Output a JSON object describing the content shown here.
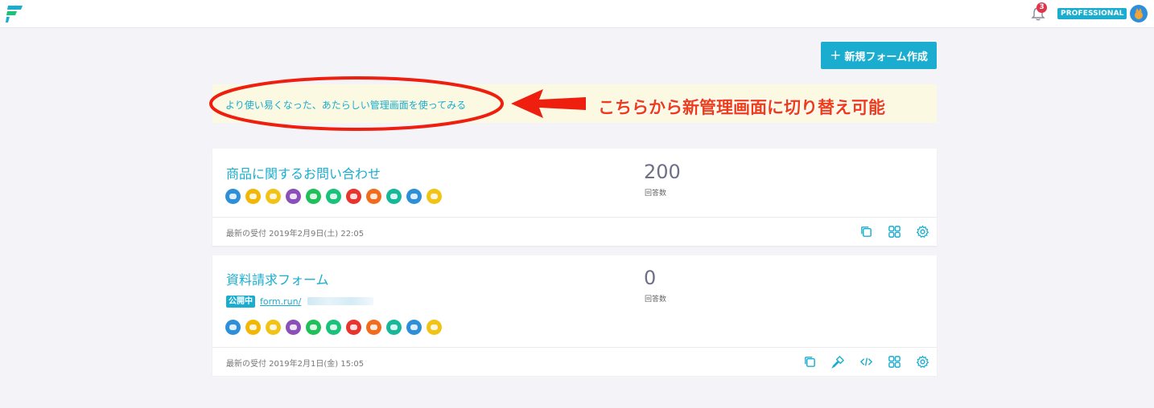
{
  "topbar": {
    "notification_count": "3",
    "plan_badge": "PROFESSIONAL"
  },
  "actions": {
    "new_form_label": "新規フォーム作成",
    "plus": "+"
  },
  "notice": {
    "link_text": "より使い易くなった、あたらしい管理画面を使ってみる"
  },
  "annotation": {
    "callout_text": "こちらから新管理画面に切り替え可能"
  },
  "forms": [
    {
      "title": "商品に関するお問い合わせ",
      "response_count": "200",
      "response_label": "回答数",
      "last_received": "最新の受付 2019年2月9日(土) 22:05"
    },
    {
      "title": "資料請求フォーム",
      "status_badge": "公開中",
      "url_prefix": "form.run/",
      "response_count": "0",
      "response_label": "回答数",
      "last_received": "最新の受付 2019年2月1日(金) 15:05"
    }
  ],
  "member_icon_colors": [
    "#2d8fd8",
    "#f2b705",
    "#f2c314",
    "#8a4fb8",
    "#1fbf5a",
    "#19c27a",
    "#e8342c",
    "#f26b1d",
    "#17b89a",
    "#2d8fd8",
    "#f2c314"
  ],
  "colors": {
    "accent": "#1aadcf",
    "annotation": "#ef3d19",
    "notice_bg": "#fbf9e2",
    "page_bg": "#f4f4f8"
  }
}
